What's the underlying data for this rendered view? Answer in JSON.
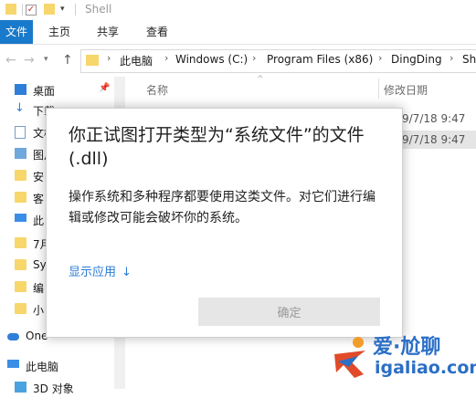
{
  "window": {
    "title": "Shell"
  },
  "ribbon": {
    "tabs": [
      "文件",
      "主页",
      "共享",
      "查看"
    ]
  },
  "address": {
    "crumbs": [
      "此电脑",
      "Windows (C:)",
      "Program Files (x86)",
      "DingDing",
      "Sh"
    ]
  },
  "navpane": {
    "items": [
      {
        "label": "桌面",
        "icon": "desktop-icon"
      },
      {
        "label": "下载",
        "icon": "download-icon"
      },
      {
        "label": "文档",
        "icon": "document-icon"
      },
      {
        "label": "图片",
        "icon": "picture-icon"
      },
      {
        "label": "安",
        "icon": "folder-icon"
      },
      {
        "label": "客",
        "icon": "folder-icon"
      },
      {
        "label": "此",
        "icon": "computer-icon"
      },
      {
        "label": "7月",
        "icon": "folder-icon"
      },
      {
        "label": "Sy",
        "icon": "folder-icon"
      },
      {
        "label": "编",
        "icon": "folder-icon"
      },
      {
        "label": "小",
        "icon": "folder-icon"
      },
      {
        "label": "One",
        "icon": "cloud-icon"
      },
      {
        "label": "此电脑",
        "icon": "computer-icon"
      },
      {
        "label": "3D 对象",
        "icon": "cube-icon"
      }
    ]
  },
  "filelist": {
    "columns": [
      "名称",
      "修改日期"
    ],
    "dates": [
      "9/7/18 9:47",
      "9/7/18 9:47"
    ]
  },
  "dialog": {
    "title": "你正试图打开类型为“系统文件”的文件(.dll)",
    "body": "操作系统和多种程序都要使用这类文件。对它们进行编辑或修改可能会破坏你的系统。",
    "link_label": "显示应用",
    "link_arrow": "↓",
    "ok_label": "确定"
  },
  "watermark": {
    "brand": "爱·尬聊",
    "url": "igaliao.com"
  },
  "colors": {
    "accent": "#1979ca",
    "link": "#2b7bd4",
    "button_bg": "#e6e6e6",
    "selected_row": "#e5e5e5"
  }
}
